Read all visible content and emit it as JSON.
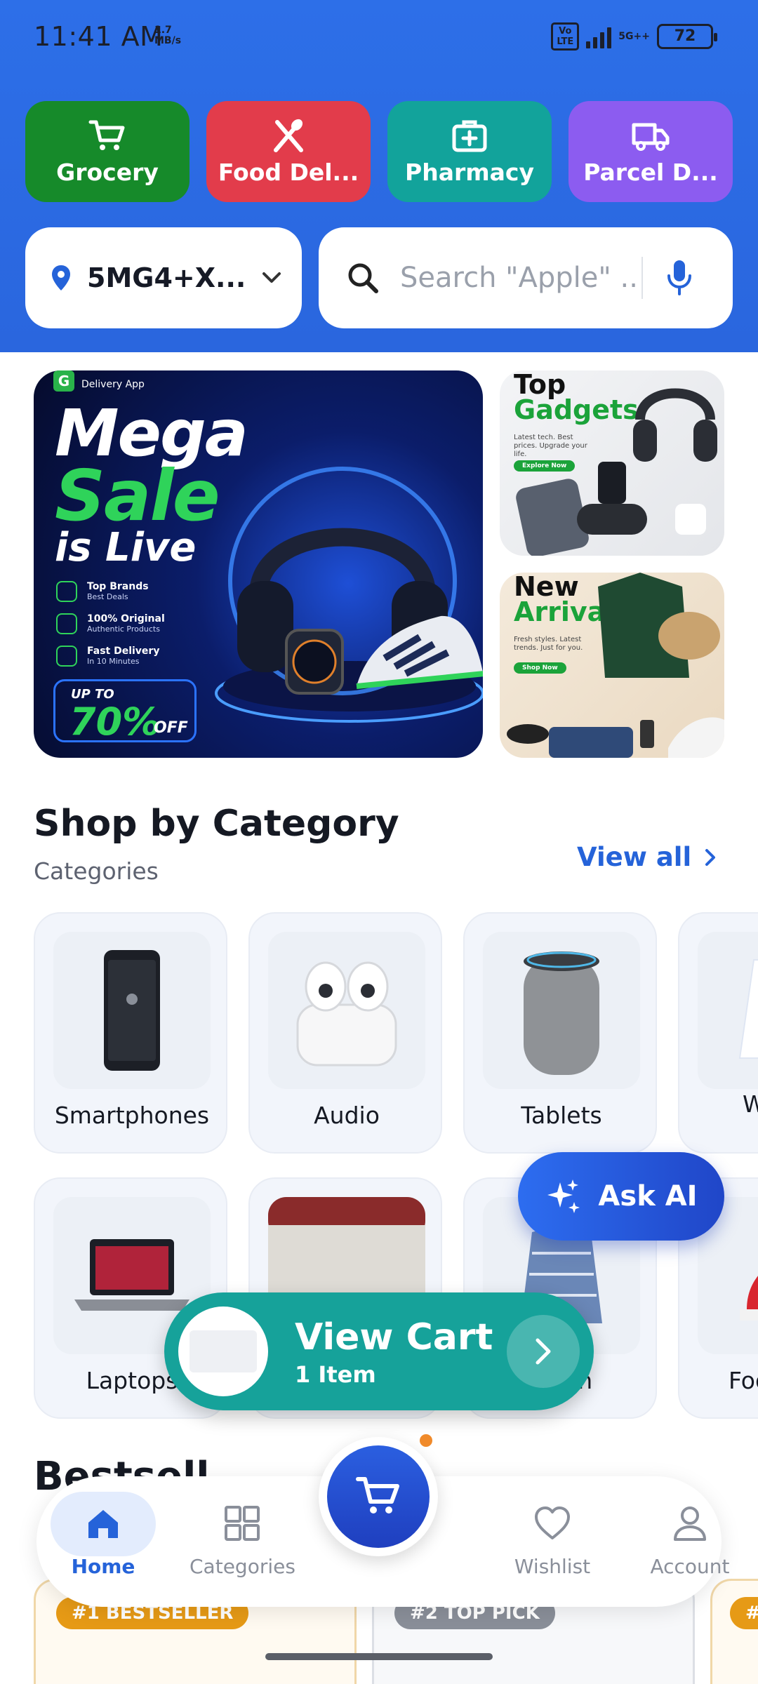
{
  "status_bar": {
    "time": "11:41 AM",
    "speed_value": "1.7",
    "speed_unit": "MB/s",
    "volte": "Vo LTE",
    "network": "5G++",
    "battery": "72"
  },
  "services": [
    {
      "label": "Grocery",
      "icon": "cart-icon",
      "color": "#168a2a"
    },
    {
      "label": "Food Del...",
      "icon": "fork-spoon-icon",
      "color": "#e23c4b"
    },
    {
      "label": "Pharmacy",
      "icon": "medkit-icon",
      "color": "#12a39b"
    },
    {
      "label": "Parcel D...",
      "icon": "truck-icon",
      "color": "#8c5cf0"
    }
  ],
  "location": {
    "value": "5MG4+X..."
  },
  "search": {
    "placeholder": "Search \"Apple\" ..."
  },
  "banners": {
    "main": {
      "brand_letter": "G",
      "brand_sub": "Delivery App",
      "line1": "Mega",
      "line2": "Sale",
      "line3": "is Live",
      "features": [
        {
          "title": "Top Brands",
          "sub": "Best Deals"
        },
        {
          "title": "100% Original",
          "sub": "Authentic Products"
        },
        {
          "title": "Fast Delivery",
          "sub": "In 10 Minutes"
        }
      ],
      "offer_prefix": "UP TO",
      "offer_value": "70%",
      "offer_suffix": "OFF"
    },
    "gadgets": {
      "line1": "Top",
      "line2": "Gadgets",
      "sub": "Latest tech. Best prices. Upgrade your life.",
      "cta": "Explore Now"
    },
    "arrivals": {
      "line1": "New",
      "line2": "Arrivals",
      "sub": "Fresh styles. Latest trends. Just for you.",
      "cta": "Shop Now"
    }
  },
  "shop_by_category": {
    "title": "Shop by Category",
    "subtitle": "Categories",
    "view_all": "View all",
    "row1": [
      "Smartphones",
      "Audio",
      "Tablets",
      "Wo Fa"
    ],
    "row2": [
      "Laptops",
      "",
      "shion",
      "Foo"
    ]
  },
  "ask_ai": {
    "label": "Ask AI"
  },
  "view_cart": {
    "title": "View Cart",
    "subtitle": "1 Item"
  },
  "bestsellers": {
    "title": "Bestsell",
    "badges": [
      "#1 BESTSELLER",
      "#2 TOP PICK",
      "#"
    ]
  },
  "bottom_nav": [
    {
      "label": "Home",
      "icon": "home-icon",
      "active": true
    },
    {
      "label": "Categories",
      "icon": "grid-icon",
      "active": false
    },
    {
      "label": "Wishlist",
      "icon": "heart-icon",
      "active": false
    },
    {
      "label": "Account",
      "icon": "person-icon",
      "active": false
    }
  ],
  "colors": {
    "header_blue": "#2d6fe8",
    "accent_blue": "#2563d9",
    "cart_teal": "#16a29a",
    "notification_dot": "#f08a2a"
  }
}
